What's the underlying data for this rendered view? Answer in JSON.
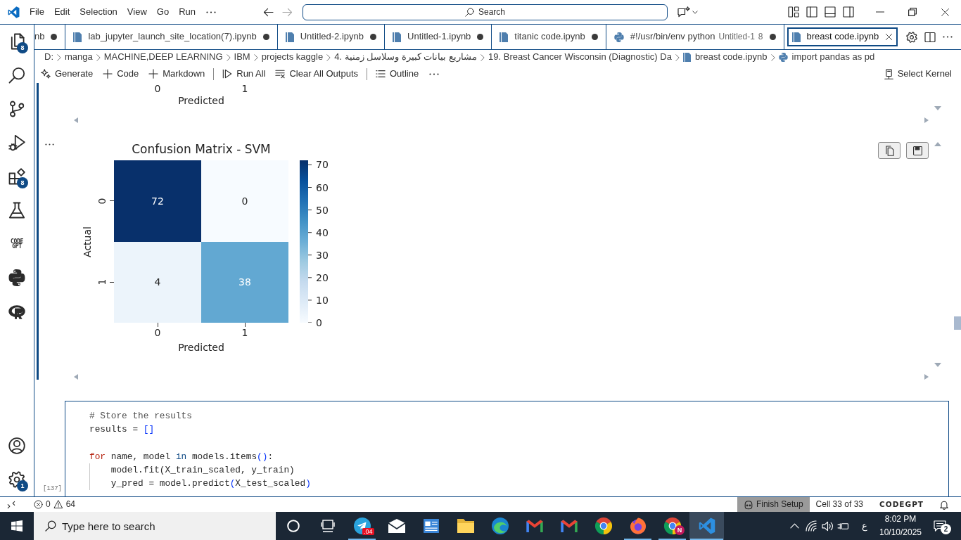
{
  "title_bar": {
    "menu": [
      {
        "label": "File"
      },
      {
        "label": "Edit"
      },
      {
        "label": "Selection"
      },
      {
        "label": "View"
      },
      {
        "label": "Go"
      },
      {
        "label": "Run"
      }
    ],
    "nav_buttons": [
      {
        "kind": "back",
        "disabled": false
      },
      {
        "kind": "forward",
        "disabled": true
      }
    ],
    "search": {
      "label": "Search"
    }
  },
  "activity_bar": {
    "top": [
      {
        "kind": "files",
        "badge": "8"
      },
      {
        "kind": "search"
      },
      {
        "kind": "branch"
      },
      {
        "kind": "debug"
      },
      {
        "kind": "blocks",
        "badge": "8"
      },
      {
        "kind": "flask"
      },
      {
        "kind": "text",
        "text": "CODE GPT"
      },
      {
        "kind": "snake"
      },
      {
        "kind": "ring"
      }
    ],
    "bottom": [
      {
        "kind": "account"
      },
      {
        "kind": "gear",
        "badge": "1"
      }
    ]
  },
  "tabs": [
    {
      "kind": "clipped",
      "label": "nb",
      "dirty": true,
      "selected": false
    },
    {
      "kind": "notebook",
      "label": "lab_jupyter_launch_site_location(7).ipynb",
      "dirty": true,
      "selected": false
    },
    {
      "kind": "notebook",
      "label": "Untitled-2.ipynb",
      "dirty": true,
      "selected": false
    },
    {
      "kind": "notebook",
      "label": "Untitled-1.ipynb",
      "dirty": true,
      "selected": false
    },
    {
      "kind": "notebook",
      "label": "titanic code.ipynb",
      "dirty": true,
      "selected": false
    },
    {
      "kind": "python",
      "label": "#!/usr/bin/env python",
      "description": "Untitled-1",
      "problems": "8",
      "dirty": true,
      "selected": false
    },
    {
      "kind": "notebook",
      "label": "breast code.ipynb",
      "dirty": false,
      "selected": true
    }
  ],
  "breadcrumbs": [
    {
      "kind": "folder",
      "text": "D:"
    },
    {
      "kind": "folder",
      "text": "manga"
    },
    {
      "kind": "folder",
      "text": "MACHINE,DEEP LEARNING"
    },
    {
      "kind": "folder",
      "text": "IBM"
    },
    {
      "kind": "folder",
      "text": "projects kaggle"
    },
    {
      "kind": "folder",
      "text": "4. مشاريع بيانات كبيرة وسلاسل زمنية"
    },
    {
      "kind": "folder",
      "text": "19. Breast Cancer Wisconsin (Diagnostic) Da"
    },
    {
      "kind": "notebook",
      "text": "breast code.ipynb"
    },
    {
      "kind": "python",
      "text": "import pandas as pd"
    }
  ],
  "notebook_toolbar": {
    "groups": [
      {
        "items": [
          {
            "kind": "sparkle",
            "label": "Generate"
          },
          {
            "kind": "plus",
            "label": "Code"
          },
          {
            "kind": "plus",
            "label": "Markdown"
          }
        ]
      },
      {
        "items": [
          {
            "kind": "run",
            "label": "Run All"
          },
          {
            "kind": "clear",
            "label": "Clear All Outputs"
          }
        ]
      },
      {
        "items": [
          {
            "kind": "list",
            "label": "Outline"
          }
        ]
      }
    ],
    "kernel": "Select Kernel"
  },
  "outputs": {
    "previous_plot": {
      "xticks": [
        "0",
        "1"
      ],
      "xlabel": "Predicted"
    },
    "heatmap": {
      "title": "Confusion Matrix - SVM",
      "ylabel": "Actual",
      "xlabel": "Predicted",
      "yticks": [
        "0",
        "1"
      ],
      "xticks": [
        "0",
        "1"
      ],
      "rows": [
        [
          "72",
          "0"
        ],
        [
          "4",
          "38"
        ]
      ],
      "colorbar_ticks": [
        "70",
        "60",
        "50",
        "40",
        "30",
        "20",
        "10",
        "0"
      ]
    }
  },
  "code_cell": {
    "execution_count": "[137]",
    "lines": [
      {
        "kind": "code",
        "tokens": [
          {
            "kind": "comment",
            "text": "# Store the results"
          }
        ]
      },
      {
        "kind": "code",
        "tokens": [
          {
            "kind": "plain",
            "text": "results = "
          },
          {
            "kind": "bracket",
            "text": "[]"
          }
        ]
      },
      {
        "kind": "blank"
      },
      {
        "kind": "code",
        "tokens": [
          {
            "kind": "keyword",
            "text": "for"
          },
          {
            "kind": "plain",
            "text": " name, model "
          },
          {
            "kind": "operator",
            "text": "in"
          },
          {
            "kind": "plain",
            "text": " models.items"
          },
          {
            "kind": "bracket",
            "text": "()"
          },
          {
            "kind": "plain",
            "text": ":"
          }
        ],
        "children": [
          {
            "kind": "code",
            "tokens": [
              {
                "kind": "plain",
                "text": "model.fit(X_train_scaled, y_train)"
              }
            ]
          },
          {
            "kind": "code",
            "tokens": [
              {
                "kind": "plain",
                "text": "y_pred = model.predict"
              },
              {
                "kind": "bracket",
                "text": "("
              },
              {
                "kind": "plain",
                "text": "X_test_scaled"
              },
              {
                "kind": "bracket",
                "text": ")"
              }
            ]
          }
        ]
      }
    ]
  },
  "status_bar": {
    "errors": "0",
    "warnings": "64",
    "items": [
      {
        "kind": "robot",
        "text": "Finish Setup",
        "highlighted": true
      },
      {
        "kind": "plain",
        "text": "Cell 33 of 33",
        "highlighted": false
      },
      {
        "kind": "logo",
        "text": "CODEGPT",
        "highlighted": false
      }
    ]
  },
  "taskbar": {
    "search": {
      "placeholder": "Type here to search"
    },
    "apps": [
      {
        "kind": "circle",
        "running": false,
        "active": false
      },
      {
        "kind": "taskview",
        "running": false,
        "active": false
      },
      {
        "kind": "plane",
        "badge": ".04",
        "running": true,
        "active": false
      },
      {
        "kind": "envelope",
        "running": false,
        "active": false
      },
      {
        "kind": "window",
        "running": false,
        "active": false
      },
      {
        "kind": "folder",
        "running": false,
        "active": false
      },
      {
        "kind": "wave",
        "running": false,
        "active": false
      },
      {
        "kind": "mletter",
        "running": false,
        "active": false
      },
      {
        "kind": "mletter",
        "running": false,
        "active": false
      },
      {
        "kind": "tricolor",
        "running": false,
        "active": false
      },
      {
        "kind": "flame",
        "running": true,
        "active": false
      },
      {
        "kind": "tricolor",
        "badge": "N",
        "running": true,
        "active": false
      },
      {
        "kind": "ribbon",
        "running": true,
        "active": true
      }
    ],
    "tray": {
      "language": "ع",
      "time": "8:02 PM",
      "date": "10/10/2025",
      "notifications": "2"
    }
  }
}
